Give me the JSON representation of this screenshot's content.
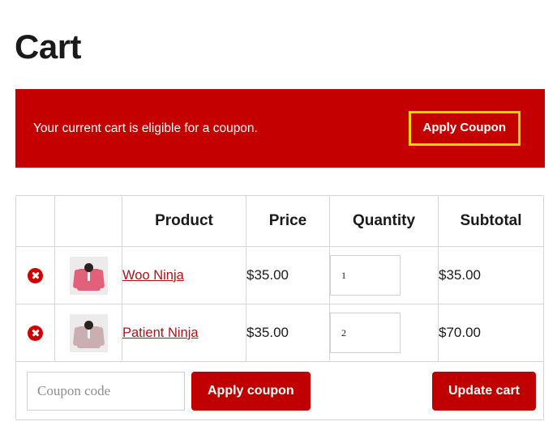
{
  "page": {
    "title": "Cart"
  },
  "notice": {
    "message": "Your current cart is eligible for a coupon.",
    "button_label": "Apply Coupon",
    "background_color": "#c50000",
    "button_border_color": "#ffd800",
    "text_color": "#ffffff"
  },
  "cart_table": {
    "headers": [
      "",
      "",
      "Product",
      "Price",
      "Quantity",
      "Subtotal"
    ],
    "rows": [
      {
        "remove_label": "×",
        "thumbnail_alt": "Woo Ninja hoodie",
        "thumbnail_color": "#e2607a",
        "product": "Woo Ninja",
        "price": "$35.00",
        "quantity": "1",
        "subtotal": "$35.00"
      },
      {
        "remove_label": "×",
        "thumbnail_alt": "Patient Ninja hoodie",
        "thumbnail_color": "#cbaeb0",
        "product": "Patient Ninja",
        "price": "$35.00",
        "quantity": "2",
        "subtotal": "$70.00"
      }
    ],
    "actions": {
      "coupon_placeholder": "Coupon code",
      "coupon_value": "",
      "apply_coupon_label": "Apply coupon",
      "update_cart_label": "Update cart"
    }
  },
  "colors": {
    "brand_red": "#c00000",
    "link_red": "#b10f18",
    "remove_red": "#d10000",
    "accent_yellow": "#ffd800",
    "border_grey": "#d6d6d6"
  }
}
